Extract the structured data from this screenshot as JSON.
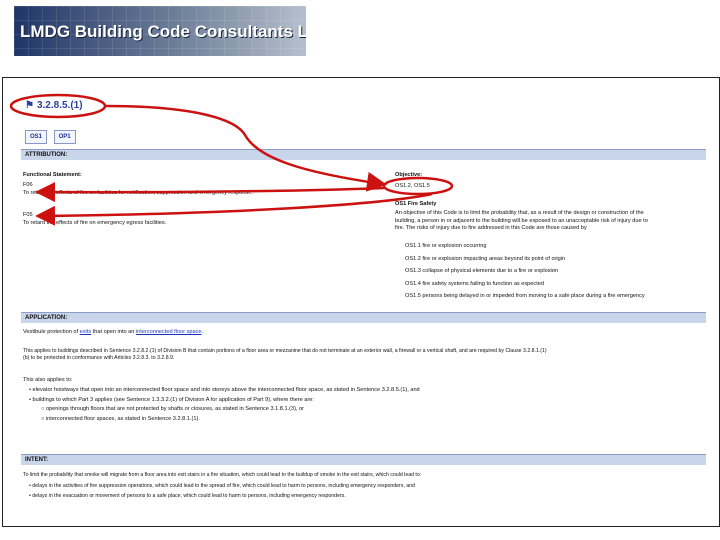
{
  "banner": {
    "company": "LMDG Building Code Consultants Ltd."
  },
  "doc": {
    "section_id": "3.2.8.5.(1)",
    "tabs": [
      "OS1",
      "OP1"
    ],
    "attribution": {
      "header": "ATTRIBUTION:",
      "functional_label": "Functional Statement:",
      "f_items": [
        {
          "code": "F06",
          "text": "To retard the effects of fire on facilities for notification, suppression and emergency response."
        },
        {
          "code": "F05",
          "text": "To retard the effects of fire on emergency egress facilities."
        }
      ],
      "objective_label": "Objective:",
      "objective_value": "OS1.2, OS1.5",
      "os_title": "OS1 Fire Safety",
      "os_intro": [
        "An objective of this Code is to limit the probability that, as a result of the design or construction of the",
        "building, a person in or adjacent to the building will be exposed to an unacceptable risk of injury due to",
        "fire. The risks of injury due to fire addressed in this Code are those caused by"
      ],
      "os_items": [
        "OS1.1 fire or explosion occurring",
        "OS1.2 fire or explosion impacting areas beyond its point of origin",
        "OS1.3 collapse of physical elements due to a fire or explosion",
        "OS1.4 fire safety systems failing to function as expected",
        "OS1.5 persons being delayed in or impeded from moving to a safe place during a fire emergency"
      ]
    },
    "application": {
      "header": "APPLICATION:",
      "line1_pre": "Vestibule protection of ",
      "line1_link1": "exits",
      "line1_mid": " that open into an ",
      "line1_link2": "interconnected floor space",
      "line1_post": ".",
      "para2": [
        "This applies to buildings described in Sentence 3.2.8.2.(1) of Division B that contain portions of a floor area or mezzanine that do not terminate at an exterior wall, a firewall or a vertical shaft, and are required by Clause 3.2.8.1.(1)",
        "(b) to be protected in conformance with Articles 3.2.8.3. to 3.2.8.9."
      ],
      "also_label": "This also applies to:",
      "bullets": [
        "elevator hoistways that open into an interconnected floor space and into storeys above the interconnected floor space, as stated in Sentence 3.2.8.5.(1), and",
        "buildings to which Part 3 applies (see Sentence 1.3.3.2.(1) of Division A for application of Part 9), where there are:"
      ],
      "sub_bullets": [
        "openings through floors that are not protected by shafts or closures, as stated in Sentence 3.1.8.1.(3), or",
        "interconnected floor spaces, as stated in Sentence 3.2.8.1.(1)."
      ]
    },
    "intent": {
      "header": "INTENT:",
      "line1": "To limit the probability that smoke will migrate from a floor area into exit stairs in a fire situation, which could lead to the buildup of smoke in the exit stairs, which could lead to:",
      "bullets": [
        "delays in the activities of fire suppression operations, which could lead to the spread of fire, which could lead to harm to persons, including emergency responders, and",
        "delays in the evacuation or movement of persons to a safe place, which could lead to harm to persons, including emergency responders."
      ]
    }
  },
  "colors": {
    "annotation": "#cc1111",
    "link": "#1a36c0",
    "header_bg": "#c9d5ea"
  }
}
